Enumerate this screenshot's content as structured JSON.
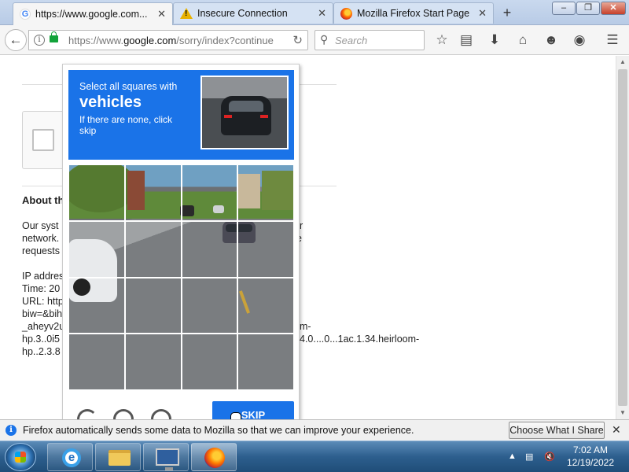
{
  "window": {
    "tabs": [
      {
        "title": "https://www.google.com...",
        "icon": "google-icon",
        "active": true
      },
      {
        "title": "Insecure Connection",
        "icon": "warning-icon",
        "active": false
      },
      {
        "title": "Mozilla Firefox Start Page",
        "icon": "firefox-icon",
        "active": false
      }
    ],
    "new_tab": "+",
    "controls": {
      "minimize": "‒",
      "maximize": "❐",
      "close": "✕"
    }
  },
  "navbar": {
    "url_prefix": "https://www.",
    "url_host": "google.com",
    "url_path": "/sorry/index?continue",
    "search_placeholder": "Search"
  },
  "page": {
    "about_heading": "About th",
    "para1_lines": [
      "Our syst",
      "network.",
      "requests"
    ],
    "para1_right": [
      "r",
      "e"
    ],
    "para2_lines": [
      "IP addres",
      "Time: 20",
      "URL: http",
      "biw=&bih",
      "_aheyv2u",
      "hp.3..0i5",
      "hp..2.3.8"
    ],
    "para2_right": [
      "m-",
      "4.0....0...1ac.1.34.heirloom-"
    ]
  },
  "captcha": {
    "prompt_line1": "Select all squares with",
    "target": "vehicles",
    "instruction": "If there are none, click skip",
    "skip_label": "SKIP",
    "colors": {
      "header": "#1a73e8"
    }
  },
  "notification": {
    "message": "Firefox automatically sends some data to Mozilla so that we can improve your experience.",
    "button": "Choose What I Share",
    "close": "✕"
  },
  "taskbar": {
    "time": "7:02 AM",
    "date": "12/19/2022"
  }
}
